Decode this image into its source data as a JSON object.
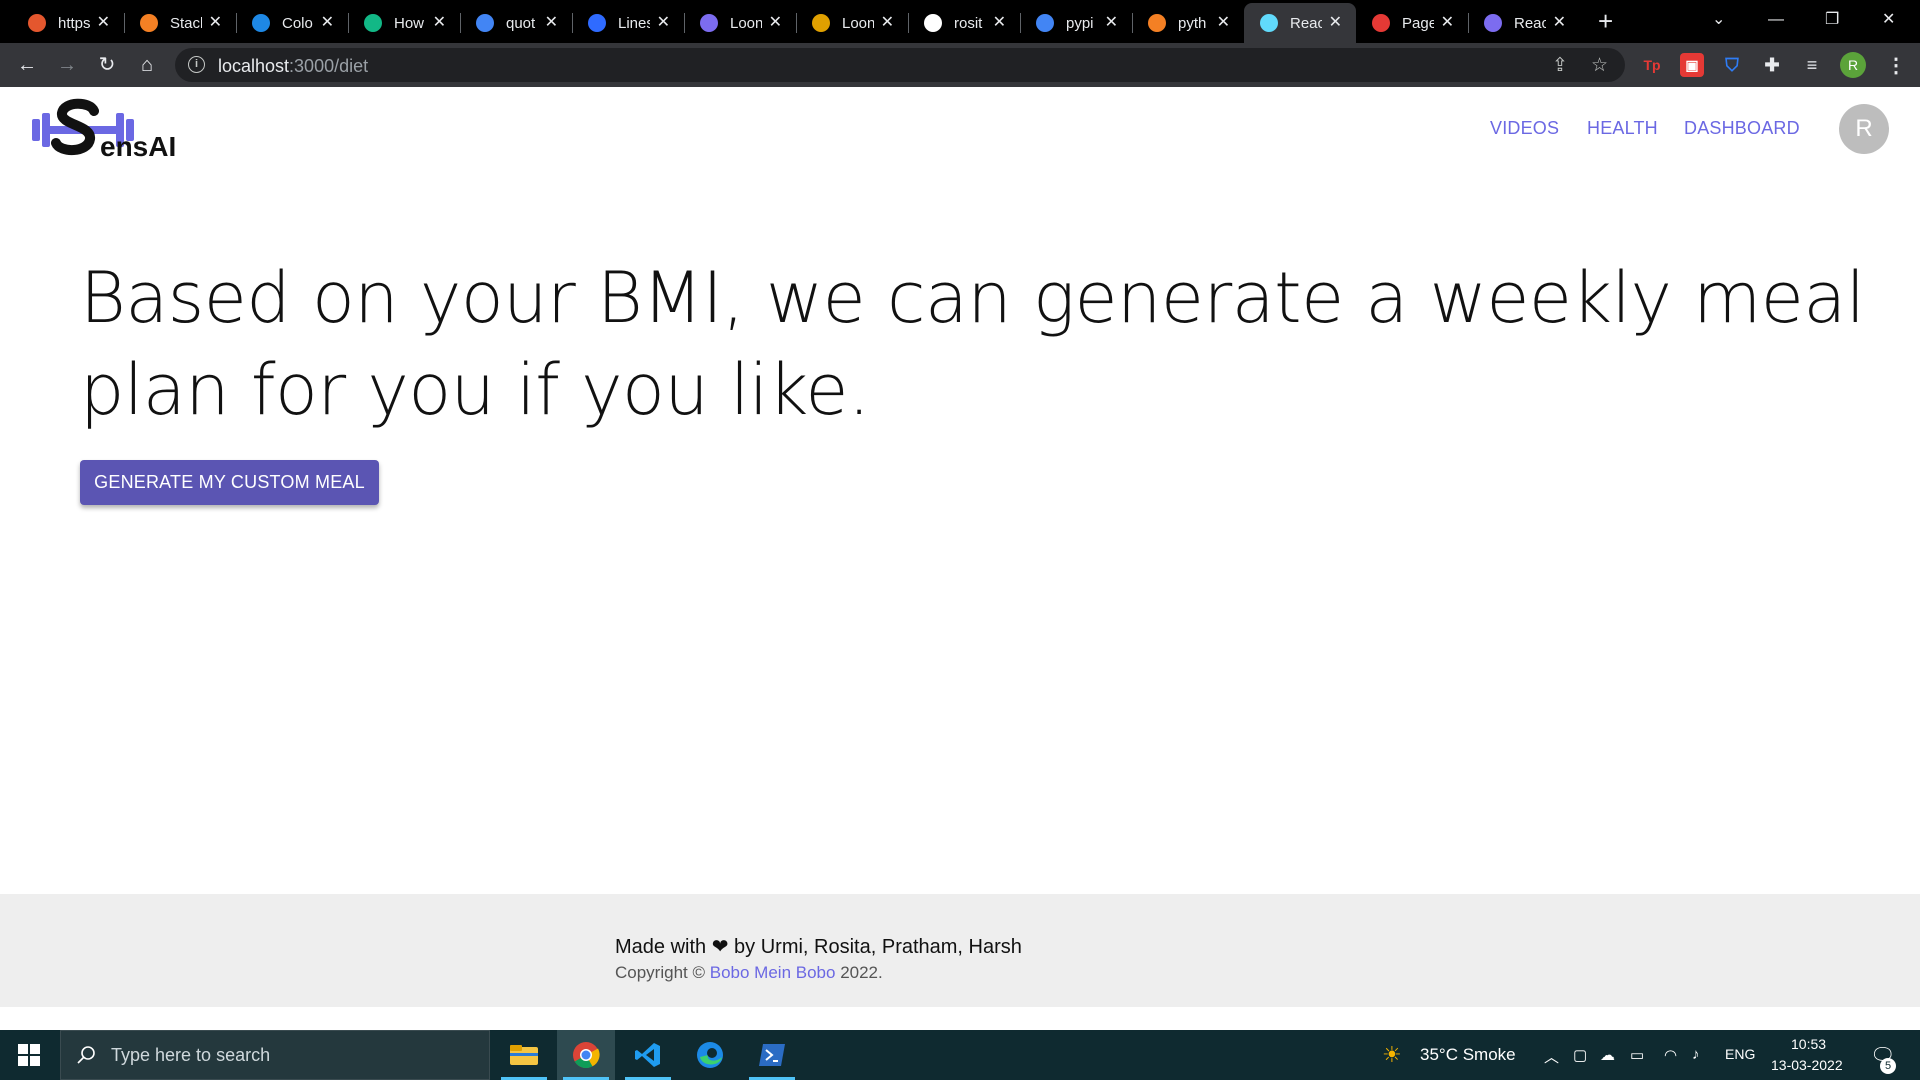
{
  "browser": {
    "tabs": [
      {
        "title": "https",
        "color": "#e4572e"
      },
      {
        "title": "Stack",
        "color": "#f48024"
      },
      {
        "title": "Colo",
        "color": "#1e88e5"
      },
      {
        "title": "How",
        "color": "#12b886"
      },
      {
        "title": "quot",
        "color": "#4285f4"
      },
      {
        "title": "Lines",
        "color": "#2f6bff"
      },
      {
        "title": "Loon",
        "color": "#7c6cf0"
      },
      {
        "title": "Loon",
        "color": "#e0a000"
      },
      {
        "title": "rosit",
        "color": "#ffffff"
      },
      {
        "title": "pypi",
        "color": "#4285f4"
      },
      {
        "title": "pyth",
        "color": "#f48024"
      },
      {
        "title": "Reac",
        "color": "#61dafb"
      },
      {
        "title": "Page",
        "color": "#e53935"
      },
      {
        "title": "Reac",
        "color": "#7c6cf0"
      }
    ],
    "url_host": "localhost",
    "url_path": ":3000/diet",
    "profile_initial": "R"
  },
  "app": {
    "nav": [
      "VIDEOS",
      "HEALTH",
      "DASHBOARD"
    ],
    "avatar_initial": "R",
    "headline": "Based on your BMI, we can generate a weekly meal plan for you if you like.",
    "cta_label": "GENERATE MY CUSTOM MEAL",
    "logo_text": "ensAI",
    "footer": {
      "made_prefix": "Made with",
      "made_suffix": "by Urmi, Rosita, Pratham, Harsh",
      "copyright_prefix": "Copyright ©",
      "copyright_link": "Bobo Mein Bobo",
      "copyright_suffix": "2022."
    }
  },
  "taskbar": {
    "search_placeholder": "Type here to search",
    "weather": "35°C  Smoke",
    "language": "ENG",
    "time": "10:53",
    "date": "13-03-2022",
    "notifications": "5"
  },
  "colors": {
    "accent": "#6b68e3",
    "button": "#5b55b3"
  }
}
